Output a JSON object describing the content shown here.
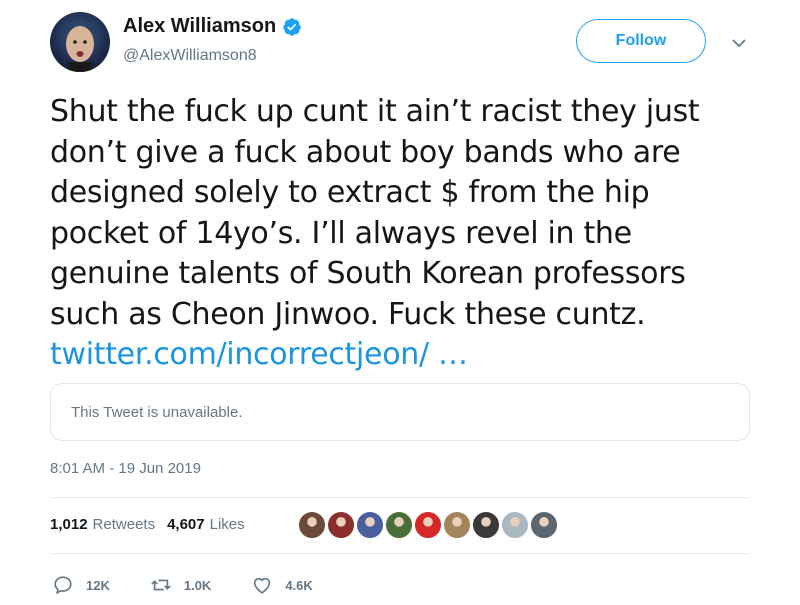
{
  "author": {
    "name": "Alex Williamson",
    "handle": "@AlexWilliamson8"
  },
  "follow_label": "Follow",
  "tweet": {
    "lines": [
      "Shut the fuck up cunt it ain’t racist they just",
      "don’t give a fuck about boy bands who are",
      "designed solely to extract $ from the hip",
      "pocket of 14yo’s. I’ll always revel in the",
      "genuine talents of South Korean professors",
      "such as Cheon Jinwoo. Fuck these cuntz."
    ],
    "link": "twitter.com/incorrectjeon/ …"
  },
  "quoted": {
    "text": "This Tweet is unavailable."
  },
  "timestamp": "8:01 AM - 19 Jun 2019",
  "stats": {
    "retweets_count": "1,012",
    "retweets_label": "Retweets",
    "likes_count": "4,607",
    "likes_label": "Likes"
  },
  "likers": [
    {
      "icon": "liker-avatar",
      "color": "#6b4a3a"
    },
    {
      "icon": "liker-avatar",
      "color": "#8a2e2e"
    },
    {
      "icon": "liker-avatar",
      "color": "#4b5f9e"
    },
    {
      "icon": "liker-avatar",
      "color": "#4a6e3a"
    },
    {
      "icon": "liker-avatar",
      "color": "#d62828"
    },
    {
      "icon": "liker-avatar",
      "color": "#a3855c"
    },
    {
      "icon": "liker-avatar",
      "color": "#3a3a3a"
    },
    {
      "icon": "liker-avatar",
      "color": "#aab8c2"
    },
    {
      "icon": "liker-avatar",
      "color": "#5c6670"
    }
  ],
  "actions": {
    "replies": "12K",
    "retweets": "1.0K",
    "likes": "4.6K"
  },
  "colors": {
    "accent": "#1da1f2",
    "link": "#1b95e0",
    "muted": "#657786"
  }
}
